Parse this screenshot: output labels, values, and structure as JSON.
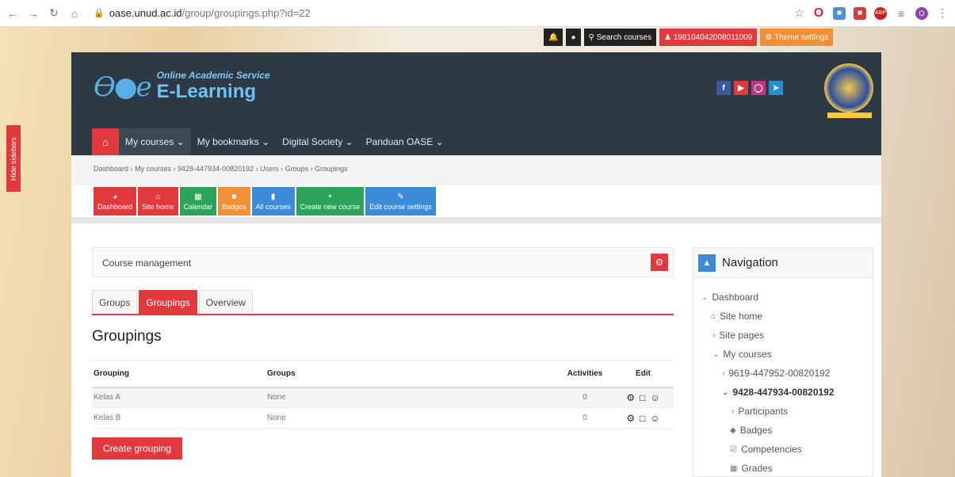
{
  "browser": {
    "url_host": "oase.unud.ac.id",
    "url_path": "/group/groupings.php?id=22"
  },
  "topbar": {
    "search_label": "Search courses",
    "user_label": "198104042008011009",
    "theme_label": "Theme settings"
  },
  "sidebar_toggle": "Hide sidebars",
  "logo": {
    "subtitle": "Online Academic Service",
    "title": "E-Learning"
  },
  "menu": {
    "items": [
      "My courses ⌄",
      "My bookmarks ⌄",
      "Digital Society ⌄",
      "Panduan OASE ⌄"
    ]
  },
  "breadcrumb": "Dashboard › My courses › 9428-447934-00820192 › Users › Groups › Groupings",
  "quick_buttons": [
    {
      "label": "Dashboard",
      "color": "#e03a3e"
    },
    {
      "label": "Site home",
      "color": "#e03a3e"
    },
    {
      "label": "Calendar",
      "color": "#2ca25a"
    },
    {
      "label": "Badges",
      "color": "#f0913a"
    },
    {
      "label": "All courses",
      "color": "#3c8bd9"
    },
    {
      "label": "Create new course",
      "color": "#2ca25a"
    },
    {
      "label": "Edit course settings",
      "color": "#3c8bd9"
    }
  ],
  "course_management": "Course management",
  "tabs": [
    "Groups",
    "Groupings",
    "Overview"
  ],
  "active_tab": "Groupings",
  "heading": "Groupings",
  "table": {
    "headers": [
      "Grouping",
      "Groups",
      "Activities",
      "Edit"
    ],
    "rows": [
      {
        "grouping": "Kelas A",
        "groups": "None",
        "activities": "0"
      },
      {
        "grouping": "Kelas B",
        "groups": "None",
        "activities": "0"
      }
    ]
  },
  "create_button": "Create grouping",
  "navigation": {
    "title": "Navigation",
    "items": [
      {
        "label": "Dashboard",
        "glyph": "⌄"
      },
      {
        "label": "Site home",
        "glyph": "⌂"
      },
      {
        "label": "Site pages",
        "glyph": "›"
      },
      {
        "label": "My courses",
        "glyph": "⌄"
      },
      {
        "label": "9619-447952-00820192",
        "glyph": "›"
      },
      {
        "label": "9428-447934-00820192",
        "glyph": "⌄"
      },
      {
        "label": "Participants",
        "glyph": "›"
      },
      {
        "label": "Badges",
        "glyph": "◆"
      },
      {
        "label": "Competencies",
        "glyph": "☑"
      },
      {
        "label": "Grades",
        "glyph": "▦"
      }
    ]
  }
}
